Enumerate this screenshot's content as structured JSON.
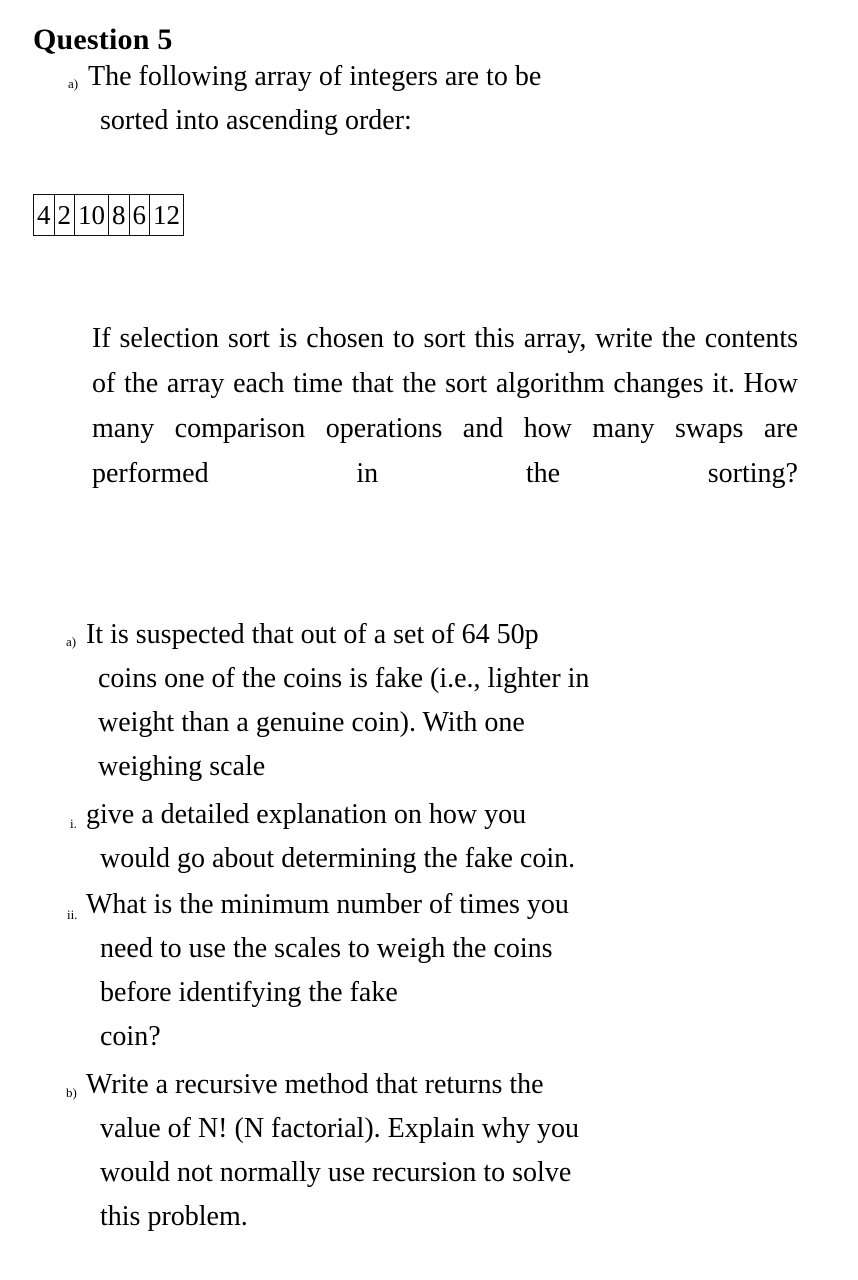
{
  "document": {
    "title": "Question 5",
    "background_color": "#ffffff",
    "text_color": "#000000"
  },
  "question5": {
    "part_a": {
      "marker": "a)",
      "line1": "The following array of integers are to be",
      "line2": "sorted into ascending order:"
    },
    "array": {
      "caption": "",
      "values": [
        "4",
        "2",
        "10",
        "8",
        "6",
        "12"
      ]
    },
    "instruction_paragraph": "If selection sort is chosen to sort this array, write the contents of the array each time that the sort algorithm changes it. How many comparison operations and how many swaps are performed in the sorting?"
  },
  "question6": {
    "part_a": {
      "marker": "a)",
      "line1": "It is suspected that out of a set of 64 50p",
      "line2": "coins one of the coins is fake (i.e., lighter in",
      "line3": "weight than a genuine coin). With one",
      "line4": "weighing scale"
    },
    "sub_i": {
      "marker": "i.",
      "line1": "give a detailed explanation on how you",
      "line2": "would go about determining the fake coin."
    },
    "sub_ii": {
      "marker": "ii.",
      "line1": "What is the minimum number of times you",
      "line2": "need to use the scales to weigh the coins",
      "line3": "before identifying the fake",
      "line4": "coin?"
    },
    "part_b": {
      "marker": "b)",
      "line1": "Write a recursive method that returns the",
      "line2": "value of N! (N factorial). Explain why you",
      "line3": "would not normally use recursion to solve",
      "line4": "this problem."
    }
  }
}
